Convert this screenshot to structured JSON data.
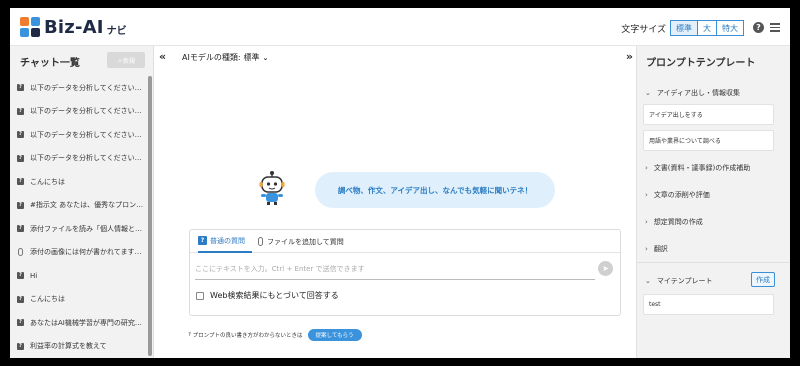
{
  "header": {
    "logo_text": "Biz-AI",
    "logo_sub": "ナビ",
    "font_size_label": "文字サイズ",
    "font_sizes": [
      "標準",
      "大",
      "特大"
    ],
    "selected_font_size": "標準",
    "help_icon": "question-circle-icon",
    "menu_icon": "hamburger-icon"
  },
  "left_sidebar": {
    "title": "チャット一覧",
    "new_button": "＋新規",
    "chats": [
      {
        "icon": "question-icon",
        "label": "以下のデータを分析してください…"
      },
      {
        "icon": "question-icon",
        "label": "以下のデータを分析してください…"
      },
      {
        "icon": "question-icon",
        "label": "以下のデータを分析してください…"
      },
      {
        "icon": "question-icon",
        "label": "以下のデータを分析してください…"
      },
      {
        "icon": "question-icon",
        "label": "こんにちは"
      },
      {
        "icon": "question-icon",
        "label": "#指示文 あなたは、優秀なプロン…"
      },
      {
        "icon": "question-icon",
        "label": "添付ファイルを読み「個人情報と…"
      },
      {
        "icon": "paperclip-icon",
        "label": "添付の画像には何が書かれてます…"
      },
      {
        "icon": "question-icon",
        "label": "Hi"
      },
      {
        "icon": "question-icon",
        "label": "こんにちは"
      },
      {
        "icon": "question-icon",
        "label": "あなたはAI機械学習が専門の研究…"
      },
      {
        "icon": "question-icon",
        "label": "利益率の計算式を教えて"
      }
    ]
  },
  "main": {
    "model_label": "AIモデルの種類:",
    "model_value": "標準",
    "greeting": "調べ物、作文、アイデア出し、なんでも気軽に聞いテネ！",
    "tabs": [
      "普通の質問",
      "ファイルを追加して質問"
    ],
    "input_placeholder": "ここにテキストを入力。Ctrl + Enter で送信できます",
    "web_search_label": "Web検索結果にもとづいて回答する",
    "tip_text": "プロンプトの良い書き方がわからないときは",
    "tip_button": "提案してもらう"
  },
  "right_sidebar": {
    "title": "プロンプトテンプレート",
    "expanded_category": "アイディア出し・情報収集",
    "expanded_items": [
      "アイデア出しをする",
      "用語や業界について調べる"
    ],
    "categories": [
      "文書(資料・議事録)の作成補助",
      "文章の添削や評価",
      "想定質問の作成",
      "翻訳"
    ],
    "my_templates_label": "マイテンプレート",
    "create_button": "作成",
    "my_templates": [
      "test"
    ]
  },
  "colors": {
    "accent": "#2b7cc4",
    "bubble_bg": "#dff0fc",
    "sidebar_bg": "#f2f2f2"
  }
}
